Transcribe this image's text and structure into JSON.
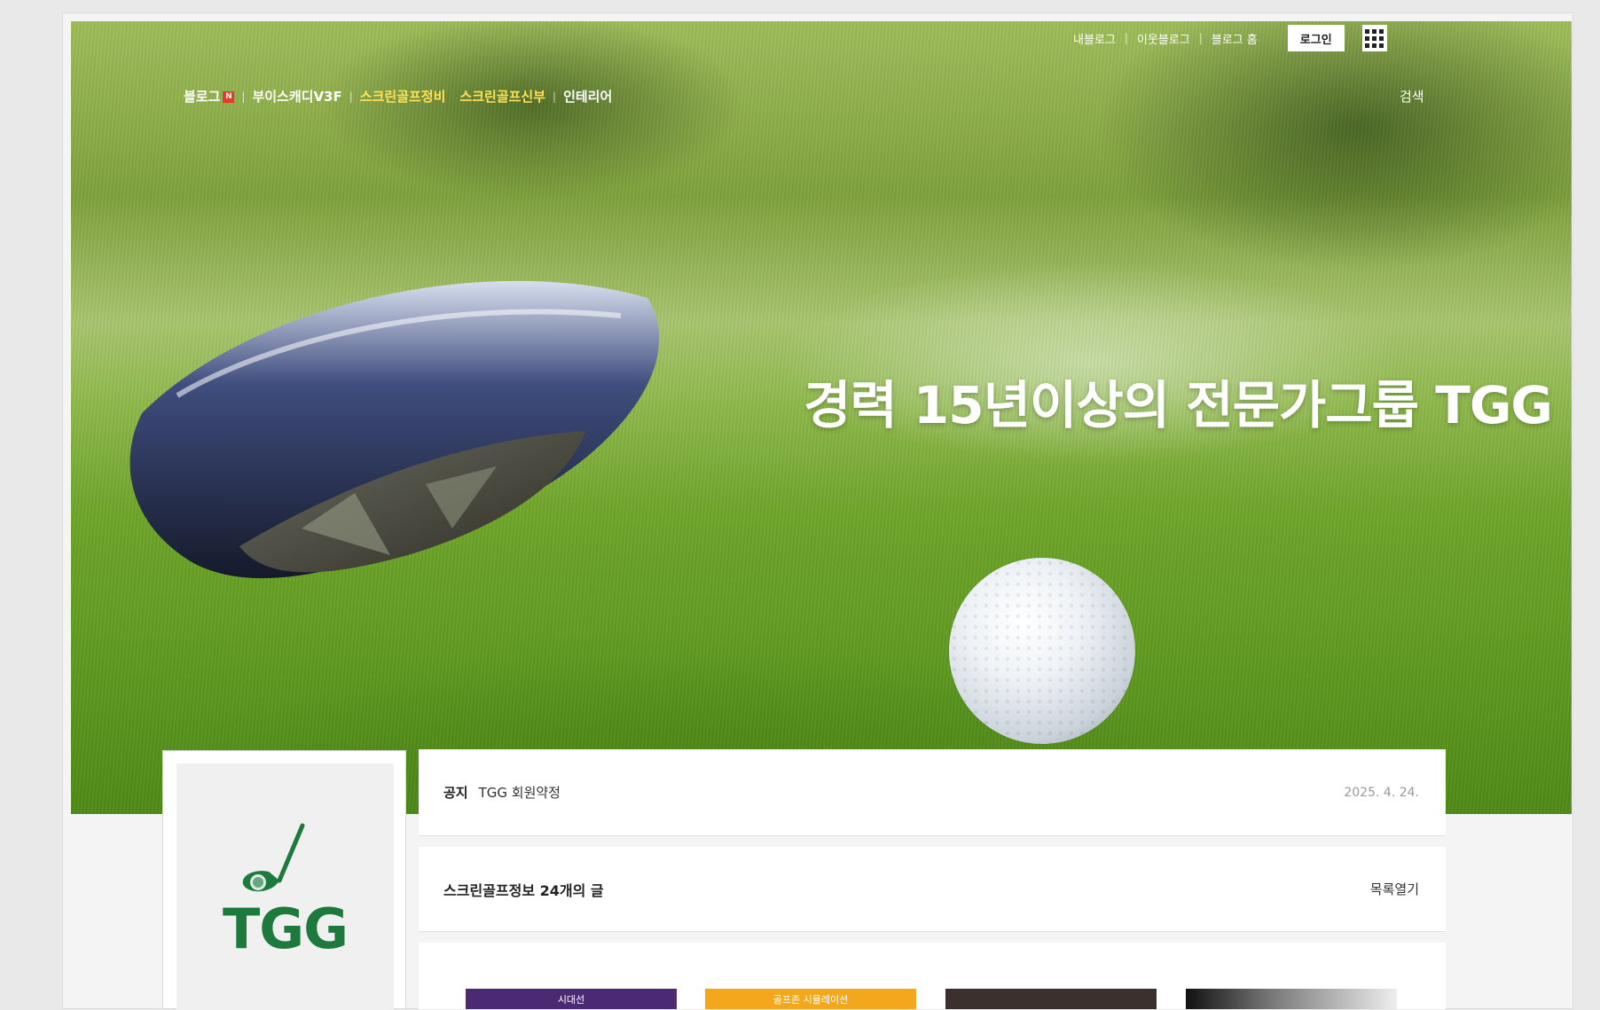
{
  "header": {
    "top_links": [
      "내블로그",
      "이웃블로그",
      "블로그 홈"
    ],
    "login_label": "로그인",
    "apps_icon": "grid-apps-icon"
  },
  "category_nav": [
    {
      "label": "블로그",
      "badge": "N"
    },
    {
      "label": "부이스캐디V3F"
    },
    {
      "label": "스크린골프정비"
    },
    {
      "label": "스크린골프신부"
    },
    {
      "label": "인테리어"
    }
  ],
  "search_label": "검색",
  "hero": {
    "title": "경력 15년이상의 전문가그룹 TGG"
  },
  "profile": {
    "logo_text": "TGG"
  },
  "notice": {
    "label": "공지",
    "title": "TGG 회원약정",
    "date": "2025. 4. 24."
  },
  "board": {
    "title": "스크린골프정보 24개의 글",
    "toggle_label": "목록열기"
  },
  "thumbnails": [
    {
      "caption": "시대선"
    },
    {
      "caption": "골프존 시뮬레이션"
    },
    {
      "caption": ""
    },
    {
      "caption": ""
    }
  ],
  "colors": {
    "active_category": "#ffe25a",
    "badge": "#e9392c",
    "logo_green": "#1d7a3c"
  }
}
